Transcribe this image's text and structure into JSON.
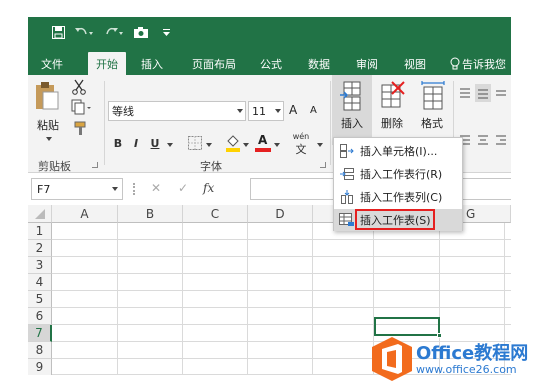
{
  "ribbon_tabs": [
    "文件",
    "开始",
    "插入",
    "页面布局",
    "公式",
    "数据",
    "审阅",
    "视图",
    "告诉我您"
  ],
  "clipboard": {
    "paste_label": "粘贴",
    "group_label": "剪贴板"
  },
  "font": {
    "name": "等线",
    "size": "11",
    "grow": "A",
    "shrink": "A",
    "bold": "B",
    "italic": "I",
    "underline": "U",
    "color_letter": "A",
    "phonetic": "wén",
    "phonetic_char": "文",
    "group_label": "字体"
  },
  "cells": {
    "insert_label": "插入",
    "delete_label": "删除",
    "format_label": "格式"
  },
  "formula_bar": {
    "name_box": "F7",
    "fx": "fx"
  },
  "grid": {
    "columns": [
      "A",
      "B",
      "C",
      "D",
      "G"
    ],
    "rows": [
      "1",
      "2",
      "3",
      "4",
      "5",
      "6",
      "7",
      "8",
      "9"
    ],
    "selected_cell": "F7"
  },
  "insert_menu": {
    "items": [
      "插入单元格(I)...",
      "插入工作表行(R)",
      "插入工作表列(C)",
      "插入工作表(S)"
    ],
    "highlighted": "插入工作表(S)"
  },
  "watermark": {
    "title": "Office教程网",
    "url": "www.office26.com"
  },
  "colors": {
    "excel_green": "#217346",
    "highlight_red": "#e52020",
    "watermark_blue": "#2c7ad1",
    "watermark_orange": "#f26b1d"
  }
}
